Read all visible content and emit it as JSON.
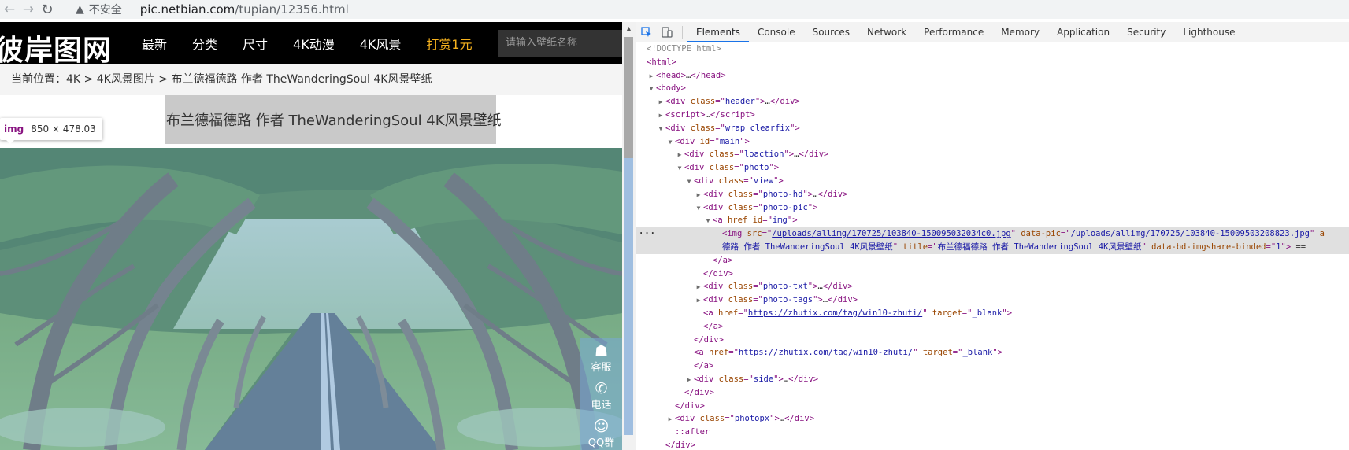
{
  "browser": {
    "security_label": "不安全",
    "url_host": "pic.netbian.com",
    "url_path": "/tupian/12356.html"
  },
  "site": {
    "logo": "彼岸图网",
    "nav": [
      "最新",
      "分类",
      "尺寸",
      "4K动漫",
      "4K风景",
      "打赏1元"
    ],
    "search_placeholder": "请输入壁纸名称",
    "breadcrumb_prefix": "当前位置：",
    "breadcrumb": [
      "4K",
      "4K风景图片",
      "布兰德福德路 作者 TheWanderingSoul 4K风景壁纸"
    ],
    "breadcrumb_sep": ">",
    "photo_title": "布兰德福德路 作者 TheWanderingSoul 4K风景壁纸",
    "inspect_tooltip": {
      "tag": "img",
      "size": "850 × 478.03"
    },
    "float_side": [
      "客服",
      "电话",
      "QQ群"
    ]
  },
  "devtools": {
    "tabs": [
      "Elements",
      "Console",
      "Sources",
      "Network",
      "Performance",
      "Memory",
      "Application",
      "Security",
      "Lighthouse"
    ],
    "active_tab": "Elements",
    "doctype": "<!DOCTYPE html>",
    "dom": {
      "head_text": "…",
      "header_class": "header",
      "wrap_class": "wrap clearfix",
      "main_id": "main",
      "loaction_class": "loaction",
      "photo_class": "photo",
      "view_class": "view",
      "photo_hd_class": "photo-hd",
      "photo_pic_class": "photo-pic",
      "a_id": "img",
      "img_src": "/uploads/allimg/170725/103840-150095032034c0.jpg",
      "img_data_pic": "/uploads/allimg/170725/103840-15009503208823.jpg",
      "img_alt_tail": "德路 作者 TheWanderingSoul 4K风景壁纸",
      "img_title": "布兰德福德路 作者 TheWanderingSoul 4K风景壁纸",
      "img_bd": "1",
      "img_eq": "==",
      "photo_txt_class": "photo-txt",
      "photo_tags_class": "photo-tags",
      "link_href": "https://zhutix.com/tag/win10-zhuti/",
      "link_target": "_blank",
      "side_class": "side",
      "photopx_class": "photopx",
      "after": "::after"
    }
  },
  "colors": {
    "nav_highlight": "#f6b21e",
    "overlay_blue": "#6fa8dc",
    "devtools_tag": "#881280",
    "devtools_attr": "#994500",
    "devtools_value": "#1a1aa6",
    "tab_underline": "#1a73e8"
  }
}
